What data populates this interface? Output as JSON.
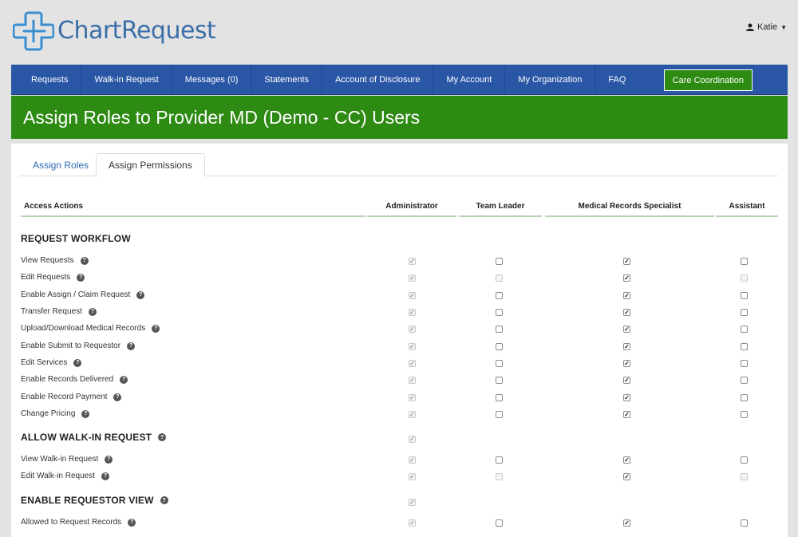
{
  "brand": {
    "name": "ChartRequest",
    "logo_icon": "medical-cross-logo-icon"
  },
  "user": {
    "name": "Katie",
    "icon": "person-icon"
  },
  "nav": {
    "items": [
      "Requests",
      "Walk-in Request",
      "Messages (0)",
      "Statements",
      "Account of Disclosure",
      "My Account",
      "My Organization",
      "FAQ"
    ],
    "care_button": "Care Coordination"
  },
  "page_title": "Assign Roles to Provider MD (Demo - CC) Users",
  "tabs": {
    "assign_roles": "Assign Roles",
    "assign_permissions": "Assign Permissions",
    "active": "Assign Permissions"
  },
  "table": {
    "headers": {
      "actions": "Access Actions",
      "admin": "Administrator",
      "team_leader": "Team Leader",
      "mrs": "Medical Records Specialist",
      "assistant": "Assistant"
    },
    "sections": [
      {
        "title": "REQUEST WORKFLOW",
        "help": false,
        "admin": null,
        "rows": [
          {
            "label": "View Requests",
            "admin": true,
            "tl": false,
            "tl_disabled": false,
            "mrs": true,
            "asst": false,
            "asst_disabled": false
          },
          {
            "label": "Edit Requests",
            "admin": true,
            "tl": false,
            "tl_disabled": true,
            "mrs": true,
            "asst": false,
            "asst_disabled": true
          },
          {
            "label": "Enable Assign / Claim Request",
            "admin": true,
            "tl": false,
            "tl_disabled": false,
            "mrs": true,
            "asst": false,
            "asst_disabled": false
          },
          {
            "label": "Transfer Request",
            "admin": true,
            "tl": false,
            "tl_disabled": false,
            "mrs": true,
            "asst": false,
            "asst_disabled": false
          },
          {
            "label": "Upload/Download Medical Records",
            "admin": true,
            "tl": false,
            "tl_disabled": false,
            "mrs": true,
            "asst": false,
            "asst_disabled": false
          },
          {
            "label": "Enable Submit to Requestor",
            "admin": true,
            "tl": false,
            "tl_disabled": false,
            "mrs": true,
            "asst": false,
            "asst_disabled": false
          },
          {
            "label": "Edit Services",
            "admin": true,
            "tl": false,
            "tl_disabled": false,
            "mrs": true,
            "asst": false,
            "asst_disabled": false
          },
          {
            "label": "Enable Records Delivered",
            "admin": true,
            "tl": false,
            "tl_disabled": false,
            "mrs": true,
            "asst": false,
            "asst_disabled": false
          },
          {
            "label": "Enable Record Payment",
            "admin": true,
            "tl": false,
            "tl_disabled": false,
            "mrs": true,
            "asst": false,
            "asst_disabled": false
          },
          {
            "label": "Change Pricing",
            "admin": true,
            "tl": false,
            "tl_disabled": false,
            "mrs": true,
            "asst": false,
            "asst_disabled": false
          }
        ]
      },
      {
        "title": "ALLOW WALK-IN REQUEST",
        "help": true,
        "admin": true,
        "rows": [
          {
            "label": "View Walk-in Request",
            "admin": true,
            "tl": false,
            "tl_disabled": false,
            "mrs": true,
            "asst": false,
            "asst_disabled": false
          },
          {
            "label": "Edit Walk-in Request",
            "admin": true,
            "tl": false,
            "tl_disabled": true,
            "mrs": true,
            "asst": false,
            "asst_disabled": true
          }
        ]
      },
      {
        "title": "ENABLE REQUESTOR VIEW",
        "help": true,
        "admin": true,
        "rows": [
          {
            "label": "Allowed to Request Records",
            "admin": true,
            "tl": false,
            "tl_disabled": false,
            "mrs": true,
            "asst": false,
            "asst_disabled": false
          }
        ]
      }
    ]
  }
}
